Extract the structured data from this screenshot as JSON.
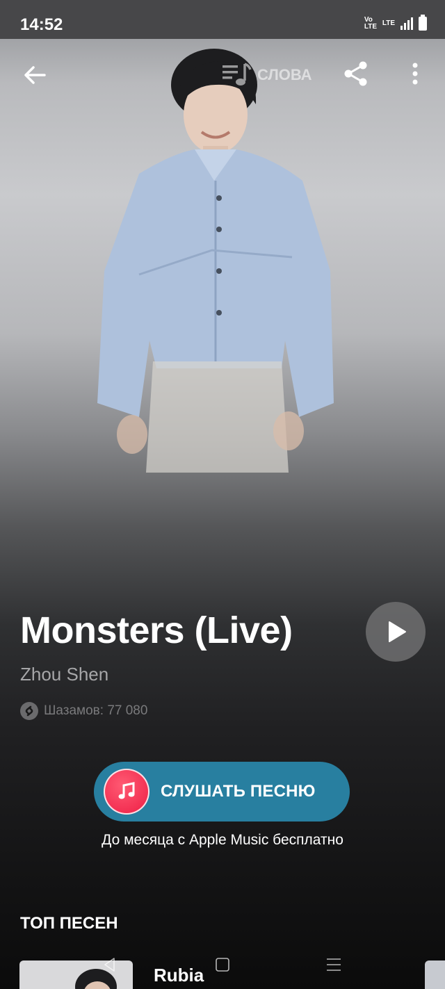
{
  "status_bar": {
    "time": "14:52",
    "volte": "Vo LTE",
    "lte": "LTE",
    "icons": [
      "volte-icon",
      "lte-icon",
      "signal-icon",
      "battery-icon"
    ]
  },
  "topbar": {
    "lyrics_label": "СЛОВА",
    "icons": [
      "back-arrow-icon",
      "lyrics-icon",
      "share-icon",
      "more-vert-icon"
    ]
  },
  "track": {
    "title": "Monsters (Live)",
    "artist": "Zhou Shen",
    "shazams": "Шазамов: 77 080"
  },
  "listen": {
    "label": "СЛУШАТЬ ПЕСНЮ",
    "note": "До месяца с Apple Music бесплатно"
  },
  "top_songs": {
    "title": "ТОП ПЕСЕН",
    "items": [
      {
        "name": "Rubia"
      }
    ]
  },
  "colors": {
    "accent": "#287fa0",
    "apple_music": "#ee1e45",
    "status_bar": "#474749"
  }
}
